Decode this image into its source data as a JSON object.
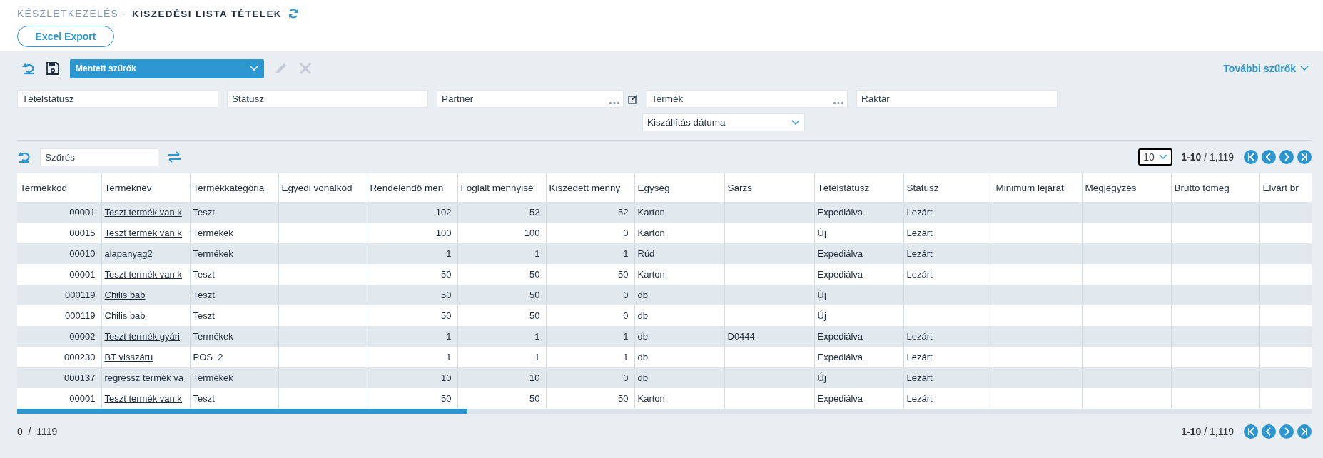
{
  "header": {
    "breadcrumb": "KÉSZLETKEZELÉS -",
    "title": "KISZEDÉSI LISTA TÉTELEK",
    "export_button": "Excel Export"
  },
  "toolbar": {
    "saved_filters": "Mentett szűrők",
    "actions": [
      {
        "kind": "edit",
        "disabled": true
      },
      {
        "kind": "delete",
        "disabled": true
      }
    ],
    "more_filters": "További szűrők"
  },
  "filters": [
    {
      "placeholder": "Tételstátusz",
      "kind": "text"
    },
    {
      "placeholder": "Státusz",
      "kind": "text"
    },
    {
      "placeholder": "Partner",
      "kind": "lookup"
    },
    {
      "placeholder": "Termék",
      "kind": "lookup"
    },
    {
      "placeholder": "Raktár",
      "kind": "text"
    },
    {
      "placeholder": "Kiszállítás dátuma",
      "kind": "select"
    }
  ],
  "table_toolbar": {
    "search_placeholder": "Szűrés",
    "page_size": "10",
    "range": "**1-10** / 1,119"
  },
  "table": {
    "columns": [
      {
        "label": "Termékkód",
        "kind": "number"
      },
      {
        "label": "Terméknév",
        "kind": "link"
      },
      {
        "label": "Termékkategória",
        "kind": "text"
      },
      {
        "label": "Egyedi vonalkód",
        "kind": "text"
      },
      {
        "label": "Rendelendő men",
        "kind": "number"
      },
      {
        "label": "Foglalt mennyisé",
        "kind": "number"
      },
      {
        "label": "Kiszedett menny",
        "kind": "number"
      },
      {
        "label": "Egység",
        "kind": "text"
      },
      {
        "label": "Sarzs",
        "kind": "text"
      },
      {
        "label": "Tételstátusz",
        "kind": "text"
      },
      {
        "label": "Státusz",
        "kind": "text"
      },
      {
        "label": "Minimum lejárat",
        "kind": "text"
      },
      {
        "label": "Megjegyzés",
        "kind": "text"
      },
      {
        "label": "Bruttó tömeg",
        "kind": "text"
      },
      {
        "label": "Elvárt br",
        "kind": "text"
      }
    ],
    "rows": [
      [
        "00001",
        "Teszt termék van k",
        "Teszt",
        null,
        "102",
        "52",
        "52",
        "Karton",
        null,
        "Expediálva",
        "Lezárt",
        null,
        null,
        null,
        null
      ],
      [
        "00015",
        "Teszt termék van k",
        "Termékek",
        null,
        "100",
        "100",
        "0",
        "Karton",
        null,
        "Új",
        "Lezárt",
        null,
        null,
        null,
        null
      ],
      [
        "00010",
        "alapanyag2",
        "Termékek",
        null,
        "1",
        "1",
        "1",
        "Rúd",
        null,
        "Expediálva",
        "Lezárt",
        null,
        null,
        null,
        null
      ],
      [
        "00001",
        "Teszt termék van k",
        "Teszt",
        null,
        "50",
        "50",
        "50",
        "Karton",
        null,
        "Expediálva",
        "Lezárt",
        null,
        null,
        null,
        null
      ],
      [
        "000119",
        "Chilis bab",
        "Teszt",
        null,
        "50",
        "50",
        "0",
        "db",
        null,
        "Új",
        null,
        null,
        null,
        null,
        null
      ],
      [
        "000119",
        "Chilis bab",
        "Teszt",
        null,
        "50",
        "50",
        "0",
        "db",
        null,
        "Új",
        null,
        null,
        null,
        null,
        null
      ],
      [
        "00002",
        "Teszt termék gyári",
        "Termékek",
        null,
        "1",
        "1",
        "1",
        "db",
        "D0444",
        "Expediálva",
        "Lezárt",
        null,
        null,
        null,
        null
      ],
      [
        "000230",
        "BT visszáru",
        "POS_2",
        null,
        "1",
        "1",
        "1",
        "db",
        null,
        "Expediálva",
        "Lezárt",
        null,
        null,
        null,
        null
      ],
      [
        "000137",
        "regressz termék va",
        "Termékek",
        null,
        "10",
        "10",
        "0",
        "db",
        null,
        "Új",
        "Lezárt",
        null,
        null,
        null,
        null
      ],
      [
        "00001",
        "Teszt termék van k",
        "Teszt",
        null,
        "50",
        "50",
        "50",
        "Karton",
        null,
        "Expediálva",
        "Lezárt",
        null,
        null,
        null,
        null
      ]
    ]
  },
  "footer": {
    "count": "0  /  1119",
    "range": "**1-10** / 1,119"
  }
}
